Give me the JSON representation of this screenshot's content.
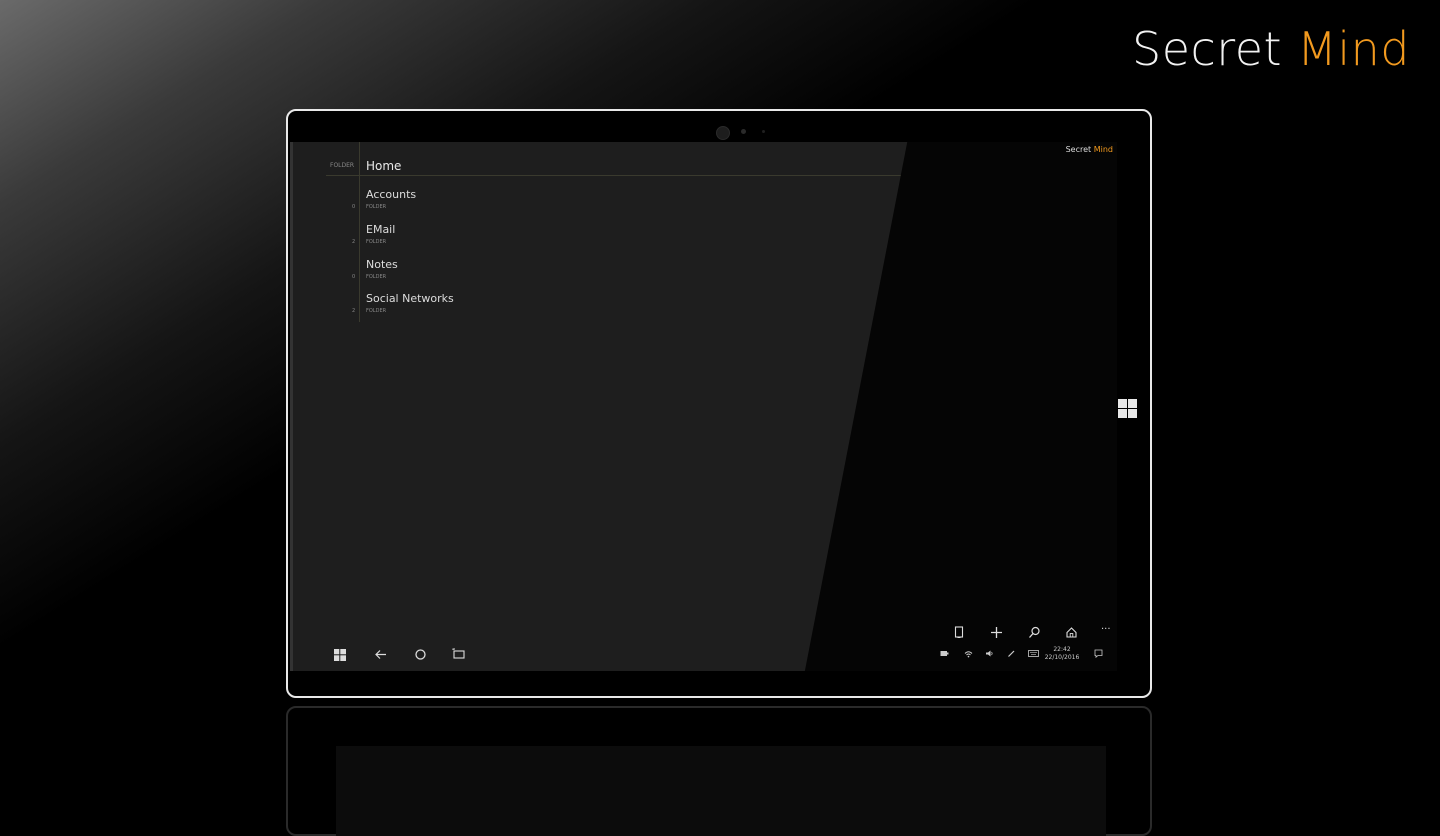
{
  "brand": {
    "word1": "Secret",
    "word2": "Mind",
    "accent_color": "#f29a1f"
  },
  "app": {
    "brand": {
      "word1": "Secret",
      "word2": "Mind"
    },
    "header": {
      "folder_tag": "FOLDER",
      "title": "Home"
    },
    "items": [
      {
        "name": "Accounts",
        "kind": "FOLDER",
        "count": "0"
      },
      {
        "name": "EMail",
        "kind": "FOLDER",
        "count": "2"
      },
      {
        "name": "Notes",
        "kind": "FOLDER",
        "count": "0"
      },
      {
        "name": "Social Networks",
        "kind": "FOLDER",
        "count": "2"
      }
    ],
    "nav": {
      "start_icon": "windows-logo-icon",
      "back_icon": "back-arrow-icon",
      "home_icon": "circle-home-icon",
      "tasks_icon": "task-view-icon"
    },
    "commandbar": {
      "icons": [
        "device-icon",
        "add-icon",
        "search-icon",
        "home-icon",
        "more-icon"
      ],
      "more_label": "···"
    },
    "tray": {
      "time": "22:42",
      "date": "22/10/2016",
      "icons": [
        "battery-icon",
        "wifi-icon",
        "volume-icon",
        "pen-icon",
        "keyboard-icon",
        "notification-icon"
      ]
    }
  }
}
